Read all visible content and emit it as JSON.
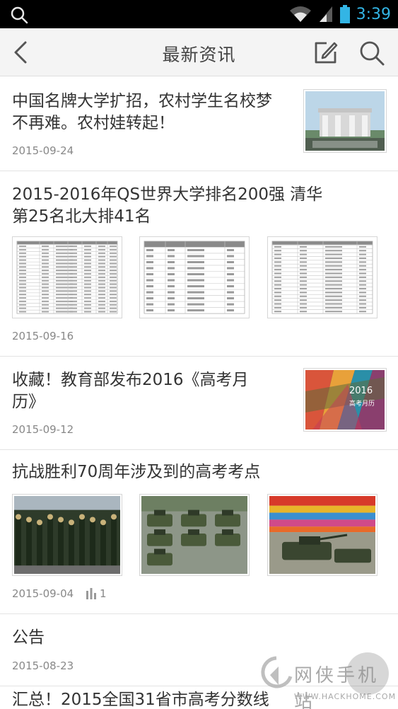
{
  "status_bar": {
    "time": "3:39",
    "icons": [
      "search-icon",
      "wifi-icon",
      "signal-icon",
      "battery-icon"
    ]
  },
  "header": {
    "title": "最新资讯",
    "icons": [
      "back-arrow-icon",
      "edit-icon",
      "search-icon"
    ]
  },
  "news": [
    {
      "title_line1": "中国名牌大学扩招，农村学生名校梦",
      "title_line2": "不再难。农村娃转起！",
      "date": "2015-09-24",
      "thumbs": [
        "campus-gate-photo"
      ]
    },
    {
      "title_line1": "2015-2016年QS世界大学排名200强 清华",
      "title_line2": "第25名北大排41名",
      "date": "2015-09-16",
      "thumbs": [
        "ranking-table-image",
        "ranking-table-image",
        "ranking-table-image"
      ]
    },
    {
      "title_line1": "收藏！教育部发布2016《高考月",
      "title_line2": "历》",
      "date": "2015-09-12",
      "thumbs": [
        "calendar-cover-image"
      ],
      "thumb_text": [
        "2016",
        "高考月历"
      ]
    },
    {
      "title_line1": "抗战胜利70周年涉及到的高考考点",
      "date": "2015-09-04",
      "views": "1",
      "thumbs": [
        "parade-soldiers-photo",
        "parade-tanks-photo",
        "parade-tanks-flowers-photo"
      ]
    },
    {
      "title_line1": "公告",
      "date": "2015-08-23"
    },
    {
      "title_line1": "汇总！2015全国31省市高考分数线"
    }
  ],
  "watermark": {
    "name": "网侠手机站",
    "url": "WWW.HACKHOME.COM"
  },
  "colors": {
    "accent": "#33b5e5",
    "header_bg": "#f4f4f4",
    "divider": "#e3e3e3",
    "date_text": "#888888"
  }
}
